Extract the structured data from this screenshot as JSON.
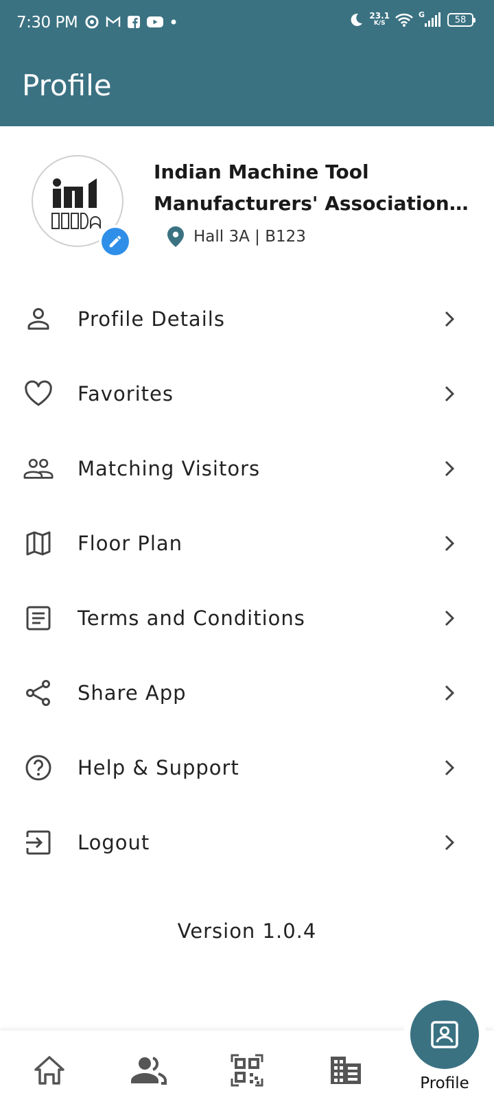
{
  "status_bar": {
    "time": "7:30 PM",
    "notification_icons": [
      "sync-icon",
      "gmail-icon",
      "facebook-icon",
      "youtube-icon",
      "dot-icon"
    ],
    "network_speed_value": "23.1",
    "network_speed_unit": "K/S",
    "signal_type": "G",
    "battery_level": "58"
  },
  "app_bar": {
    "title": "Profile"
  },
  "profile": {
    "org_name_line1": "Indian Machine Tool",
    "org_name_line2": "Manufacturers' Association | …",
    "location": "Hall 3A | B123",
    "avatar_icon": "imtma-logo",
    "edit_icon": "pencil-icon"
  },
  "menu": {
    "items": [
      {
        "label": "Profile Details",
        "icon": "person-icon"
      },
      {
        "label": "Favorites",
        "icon": "heart-icon"
      },
      {
        "label": "Matching Visitors",
        "icon": "people-icon"
      },
      {
        "label": "Floor Plan",
        "icon": "map-icon"
      },
      {
        "label": "Terms and Conditions",
        "icon": "document-icon"
      },
      {
        "label": "Share App",
        "icon": "share-icon"
      },
      {
        "label": "Help & Support",
        "icon": "help-icon"
      },
      {
        "label": "Logout",
        "icon": "logout-icon"
      }
    ]
  },
  "version": "Version 1.0.4",
  "bottom_nav": {
    "items": [
      {
        "icon": "home-icon"
      },
      {
        "icon": "people-icon"
      },
      {
        "icon": "qr-code-icon"
      },
      {
        "icon": "building-icon"
      }
    ],
    "active_label": "Profile",
    "active_icon": "profile-card-icon"
  },
  "colors": {
    "primary": "#3a7282",
    "edit_badge": "#2f8fe8",
    "icon_gray": "#444444"
  }
}
